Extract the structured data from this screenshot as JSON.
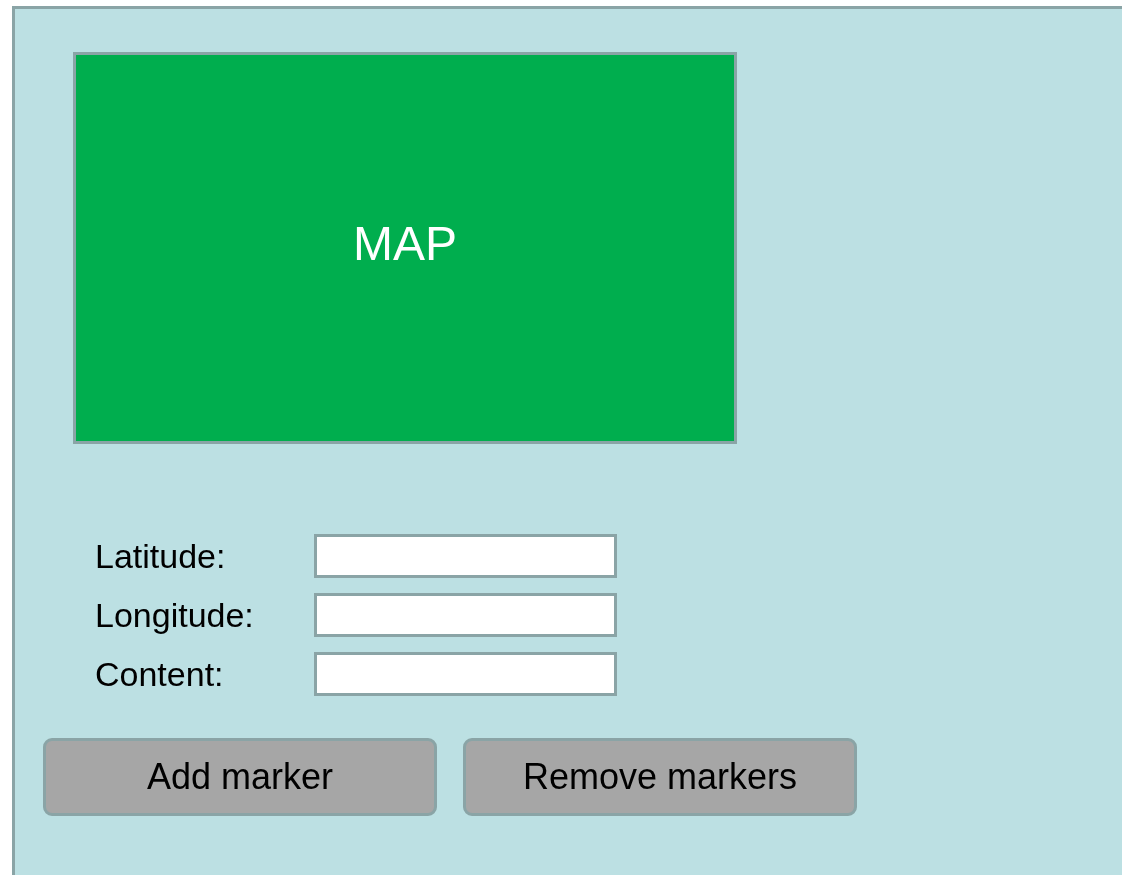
{
  "map": {
    "label": "MAP"
  },
  "fields": [
    {
      "label": "Latitude:"
    },
    {
      "label": "Longitude:"
    },
    {
      "label": "Content:"
    }
  ],
  "buttons": [
    "Add marker",
    "Remove markers"
  ]
}
